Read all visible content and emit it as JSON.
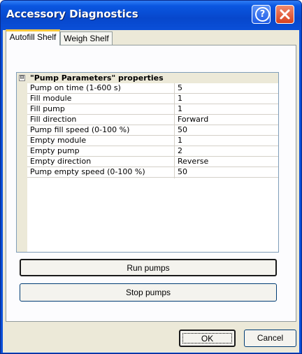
{
  "window": {
    "title": "Accessory Diagnostics"
  },
  "tabs": [
    "Autofill Shelf",
    "Weigh Shelf"
  ],
  "grid": {
    "category": "\"Pump Parameters\" properties",
    "expander": "⊟",
    "rows": [
      {
        "name": "Pump on time (1-600 s)",
        "value": "5"
      },
      {
        "name": "Fill module",
        "value": "1"
      },
      {
        "name": "Fill pump",
        "value": "1"
      },
      {
        "name": "Fill direction",
        "value": "Forward"
      },
      {
        "name": "Pump fill speed (0-100 %)",
        "value": "50"
      },
      {
        "name": "Empty module",
        "value": "1"
      },
      {
        "name": "Empty pump",
        "value": "2"
      },
      {
        "name": "Empty direction",
        "value": "Reverse"
      },
      {
        "name": "Pump empty speed (0-100 %)",
        "value": "50"
      }
    ]
  },
  "buttons": {
    "run": "Run pumps",
    "stop": "Stop pumps",
    "ok": "OK",
    "cancel": "Cancel"
  },
  "icons": {
    "help": "help-icon",
    "close": "close-icon"
  },
  "colors": {
    "titlebar": "#0a4fd8",
    "close": "#d8421f",
    "tab_highlight": "#ffc83c"
  }
}
